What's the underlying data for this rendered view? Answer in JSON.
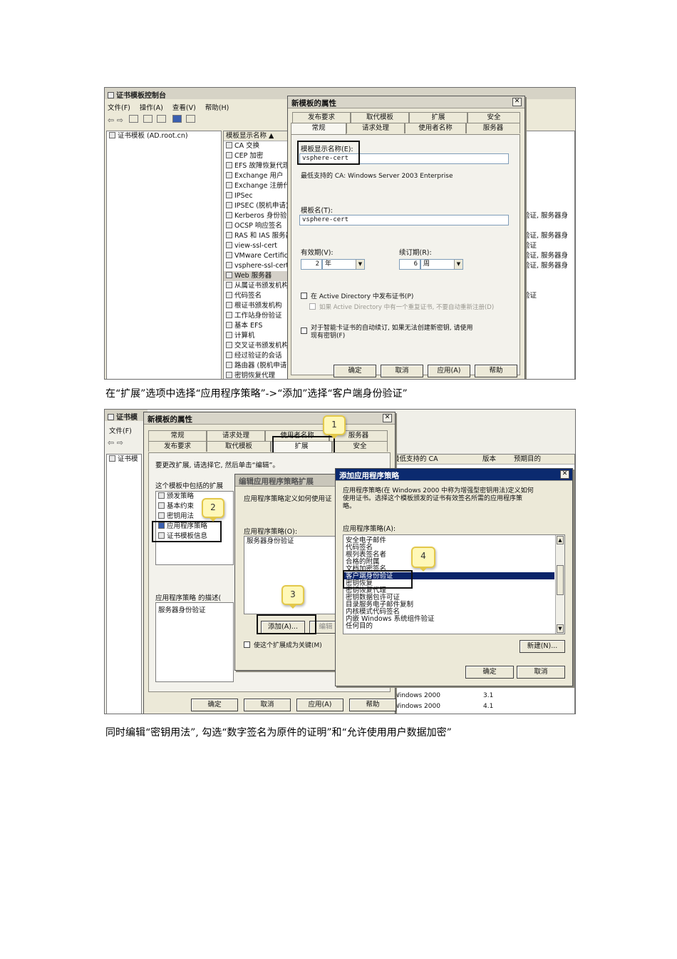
{
  "shot1": {
    "app_title": "证书模板控制台",
    "menu": [
      "文件(F)",
      "操作(A)",
      "查看(V)",
      "帮助(H)"
    ],
    "tree_root": "证书模板 (AD.root.cn)",
    "column_header": "模板显示名称 ▲",
    "templates": [
      "CA 交换",
      "CEP 加密",
      "EFS 故障恢复代理",
      "Exchange 用户",
      "Exchange 注册代理",
      "IPSec",
      "IPSEC (脱机申请)",
      "Kerberos 身份验证",
      "OCSP 响应签名",
      "RAS 和 IAS 服务器",
      "view-ssl-cert",
      "VMware Certificate",
      "vsphere-ssl-cert",
      "Web 服务器",
      "从属证书颁发机构",
      "代码签名",
      "根证书颁发机构",
      "工作站身份验证",
      "基本 EFS",
      "计算机",
      "交叉证书颁发机构",
      "经过验证的会话",
      "路由器 (脱机申请)",
      "密钥恢复代理"
    ],
    "right_fragments": [
      "验证, 服务器身",
      "验证, 服务器身",
      "验证",
      "验证, 服务器身",
      "验证, 服务器身",
      "验证"
    ],
    "dialog": {
      "title": "新模板的属性",
      "tabs_row1": [
        "发布要求",
        "取代模板",
        "扩展",
        "安全"
      ],
      "tabs_row2": [
        "常规",
        "请求处理",
        "使用者名称",
        "服务器"
      ],
      "display_name_label": "模板显示名称(E):",
      "display_name_value": "vsphere-cert",
      "min_ca": "最低支持的 CA:  Windows Server 2003 Enterprise",
      "template_name_label": "模板名(T):",
      "template_name_value": "vsphere-cert",
      "validity_label": "有效期(V):",
      "validity_value": "2",
      "validity_unit": "年",
      "renewal_label": "续订期(R):",
      "renewal_value": "6",
      "renewal_unit": "周",
      "publish_ad": "在 Active Directory 中发布证书(P)",
      "no_reenroll": "如果 Active Directory 中有一个重复证书, 不要自动重新注册(D)",
      "smartcard_line1": "对于智能卡证书的自动续订, 如果无法创建新密钥, 请使用",
      "smartcard_line2": "现有密钥(F)",
      "buttons": [
        "确定",
        "取消",
        "应用(A)",
        "帮助"
      ]
    }
  },
  "caption1": "在“扩展”选项中选择“应用程序策略”->“添加”选择“客户端身份验证”",
  "shot2": {
    "app_title": "证书模",
    "menu_file": "文件(F)",
    "tree_root": "证书模",
    "dialog": {
      "title": "新模板的属性",
      "tabs_row1": [
        "常规",
        "请求处理",
        "使用者名称",
        "服务器"
      ],
      "tabs_row2": [
        "发布要求",
        "取代模板",
        "扩展",
        "安全"
      ],
      "instruction": "要更改扩展, 请选择它, 然后单击“编辑”。",
      "ext_label": "这个模板中包括的扩展",
      "extensions": [
        "颁发策略",
        "基本约束",
        "密钥用法",
        "应用程序策略",
        "证书模板信息"
      ],
      "desc_label": "应用程序策略 的描述(",
      "desc_value": "服务器身份验证",
      "buttons": [
        "确定",
        "取消",
        "应用(A)",
        "帮助"
      ]
    },
    "edit_dialog": {
      "title": "编辑应用程序策略扩展",
      "desc": "应用程序策略定义如何使用证",
      "list_label": "应用程序策略(O):",
      "list_items": [
        "服务器身份验证"
      ],
      "add_button": "添加(A)...",
      "edit_button": "编辑",
      "critical": "使这个扩展成为关键(M)"
    },
    "add_dialog": {
      "title": "添加应用程序策略",
      "desc_line1": "应用程序策略(在 Windows 2000 中称为增强型密钥用法)定义如何",
      "desc_line2": "使用证书。选择这个模板颁发的证书有效签名所需的应用程序策",
      "desc_line3": "略。",
      "list_label": "应用程序策略(A):",
      "policies": [
        "安全电子邮件",
        "代码签名",
        "根列表签名者",
        "合格的附属",
        "文档加密签名",
        "客户端身份验证",
        "密钥恢复",
        "密钥恢复代理",
        "密钥数据包许可证",
        "目录服务电子邮件复制",
        "内核模式代码签名",
        "内嵌 Windows 系统组件验证",
        "任何目的"
      ],
      "selected_index": 5,
      "new_button": "新建(N)...",
      "ok_button": "确定",
      "cancel_button": "取消"
    },
    "background": {
      "header_min_ca": "最低支持的 CA",
      "header_version": "版本",
      "header_purpose": "预期目的",
      "rows": [
        [
          "Windows 2000",
          "3.1"
        ],
        [
          "Windows 2000",
          "4.1"
        ]
      ]
    },
    "callouts": [
      "1",
      "2",
      "3",
      "4"
    ]
  },
  "caption2": "同时编辑“密钥用法”, 勾选“数字签名为原件的证明”和“允许使用用户数据加密”"
}
